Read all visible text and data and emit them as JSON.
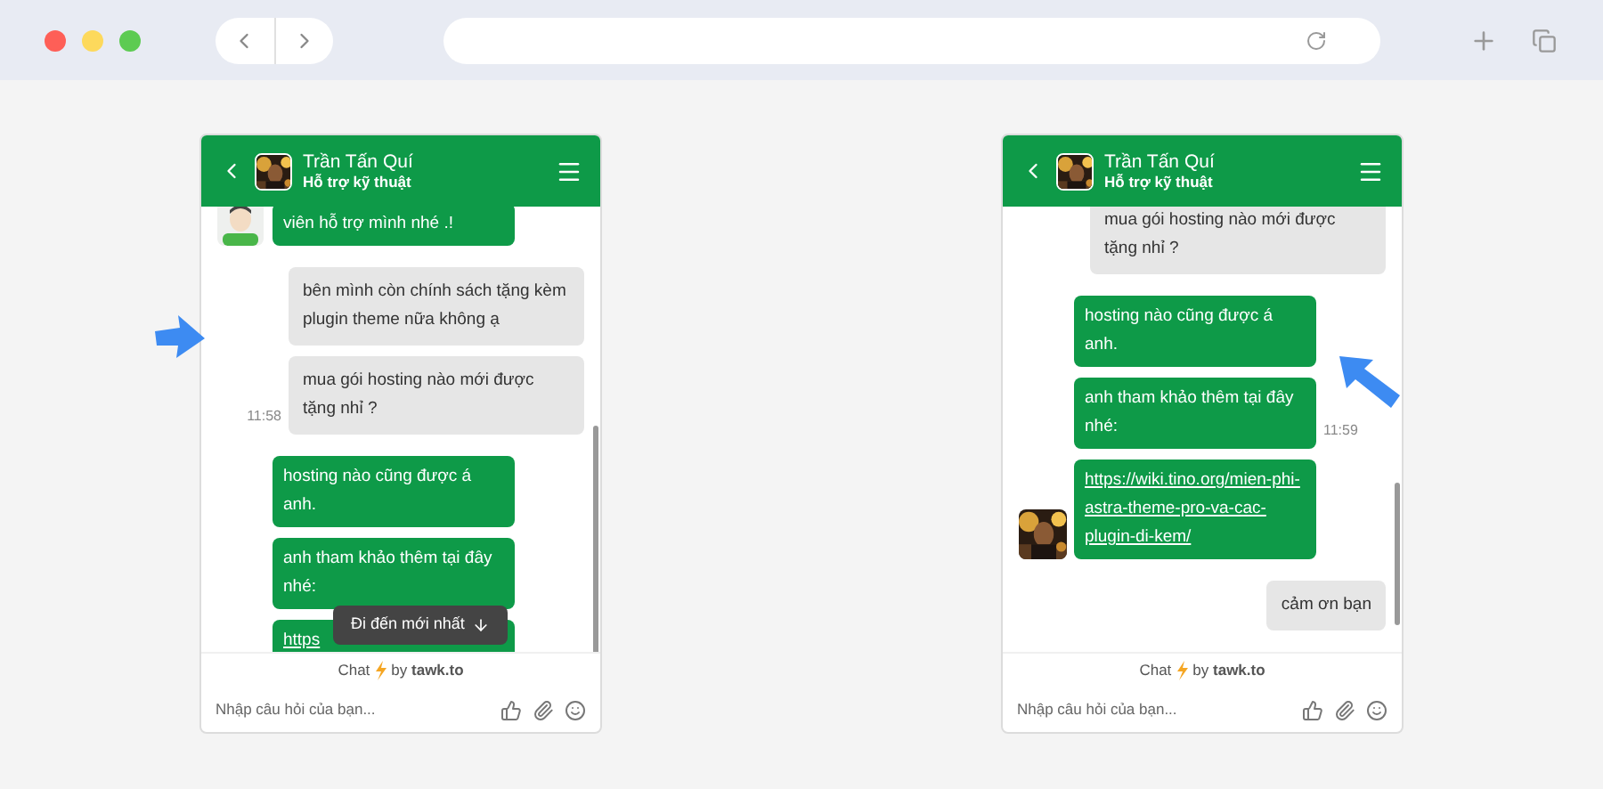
{
  "widgets": [
    {
      "header": {
        "name": "Trần Tấn Quí",
        "subtitle": "Hỗ trợ kỹ thuật"
      },
      "messages": [
        {
          "kind": "received",
          "text": "viên hỗ trợ mình nhé .!",
          "avatar": {
            "kind": "cartoon"
          }
        },
        {
          "kind": "sent",
          "text": "bên mình còn chính sách tặng kèm plugin theme nữa không ạ"
        },
        {
          "kind": "sent",
          "text": "mua gói hosting nào mới được tặng nhỉ ?",
          "time": "11:58"
        },
        {
          "kind": "received",
          "text": "hosting nào cũng được á anh."
        },
        {
          "kind": "received",
          "text": "anh tham khảo thêm tại đây nhé:"
        },
        {
          "kind": "link",
          "text": "https"
        }
      ],
      "jump_button": {
        "label": "Đi đến mới nhất"
      },
      "powered": {
        "prefix": "Chat",
        "suffix": "by **tawk.to**"
      },
      "input": {
        "placeholder": "Nhập câu hỏi của bạn..."
      }
    },
    {
      "header": {
        "name": "Trần Tấn Quí",
        "subtitle": "Hỗ trợ kỹ thuật"
      },
      "messages": [
        {
          "kind": "sent",
          "text": "mua gói hosting nào mới được tặng nhỉ ?"
        },
        {
          "kind": "received",
          "text": "hosting nào cũng được á anh."
        },
        {
          "kind": "received",
          "text": "anh tham khảo thêm tại đây nhé:",
          "time": "11:59"
        },
        {
          "kind": "link",
          "text": "https://wiki.tino.org/mien-phi-astra-theme-pro-va-cac-plugin-di-kem/"
        },
        {
          "kind": "sent",
          "text": "cảm ơn bạn"
        }
      ],
      "powered": {
        "prefix": "Chat",
        "suffix": "by **tawk.to**"
      },
      "input": {
        "placeholder": "Nhập câu hỏi của bạn..."
      }
    }
  ],
  "arrows": [
    {
      "kind": "right"
    },
    {
      "kind": "upleft"
    }
  ]
}
